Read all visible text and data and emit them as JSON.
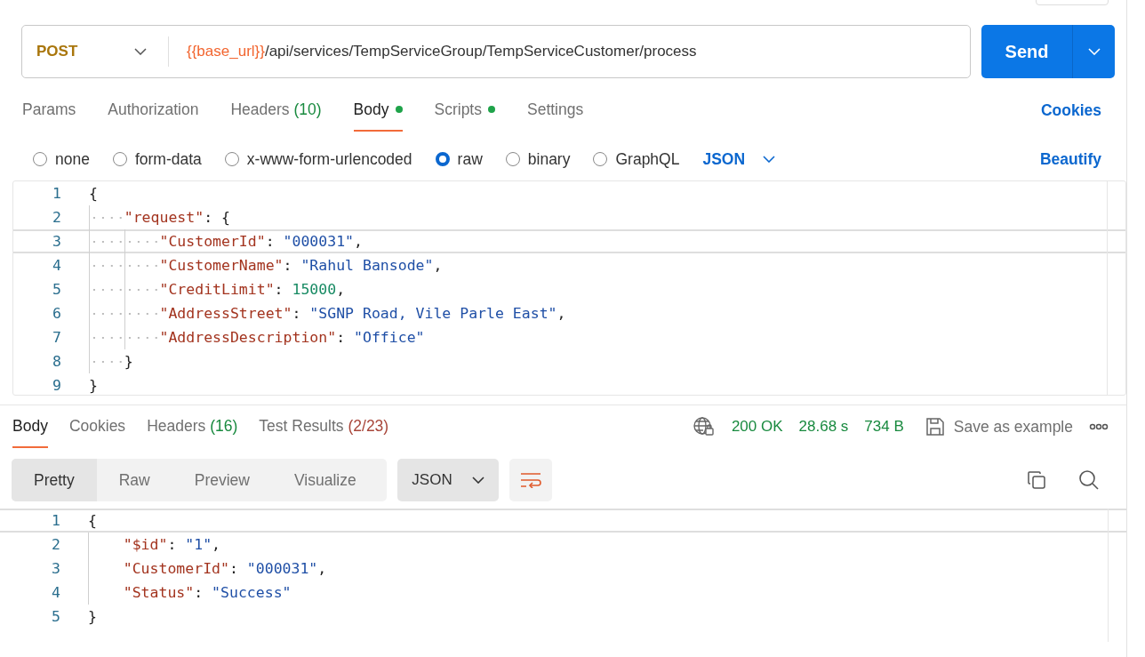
{
  "request_bar": {
    "method": "POST",
    "url_variable": "{{base_url}}",
    "url_path": "/api/services/TempServiceGroup/TempServiceCustomer/process",
    "send_label": "Send"
  },
  "request_tabs": [
    {
      "label": "Params",
      "selected": false,
      "dot": false
    },
    {
      "label": "Authorization",
      "selected": false,
      "dot": false
    },
    {
      "label": "Headers",
      "count": {
        "text": "(10)",
        "color": "#198a3f"
      },
      "selected": false,
      "dot": false
    },
    {
      "label": "Body",
      "selected": true,
      "dot": true
    },
    {
      "label": "Scripts",
      "selected": false,
      "dot": true
    },
    {
      "label": "Settings",
      "selected": false,
      "dot": false
    }
  ],
  "cookies_link": "Cookies",
  "body_modes": [
    {
      "label": "none",
      "selected": false
    },
    {
      "label": "form-data",
      "selected": false
    },
    {
      "label": "x-www-form-urlencoded",
      "selected": false
    },
    {
      "label": "raw",
      "selected": true
    },
    {
      "label": "binary",
      "selected": false
    },
    {
      "label": "GraphQL",
      "selected": false
    }
  ],
  "body_format": "JSON",
  "beautify_link": "Beautify",
  "request_editor": {
    "show_whitespace": true,
    "lines": [
      {
        "number": "1",
        "current": false,
        "tokens": [
          {
            "kind": "punct",
            "text": "{"
          }
        ],
        "children": [
          {
            "number": "2",
            "current": false,
            "tokens": [
              {
                "kind": "key",
                "text": "\"request\""
              },
              {
                "kind": "punct",
                "text": ": {"
              }
            ],
            "children": [
              {
                "number": "3",
                "current": true,
                "tokens": [
                  {
                    "kind": "key",
                    "text": "\"CustomerId\""
                  },
                  {
                    "kind": "punct",
                    "text": ": "
                  },
                  {
                    "kind": "string",
                    "text": "\"000031\""
                  },
                  {
                    "kind": "punct",
                    "text": ","
                  }
                ]
              },
              {
                "number": "4",
                "current": false,
                "tokens": [
                  {
                    "kind": "key",
                    "text": "\"CustomerName\""
                  },
                  {
                    "kind": "punct",
                    "text": ": "
                  },
                  {
                    "kind": "string",
                    "text": "\"Rahul Bansode\""
                  },
                  {
                    "kind": "punct",
                    "text": ","
                  }
                ]
              },
              {
                "number": "5",
                "current": false,
                "tokens": [
                  {
                    "kind": "key",
                    "text": "\"CreditLimit\""
                  },
                  {
                    "kind": "punct",
                    "text": ": "
                  },
                  {
                    "kind": "number",
                    "text": "15000"
                  },
                  {
                    "kind": "punct",
                    "text": ","
                  }
                ]
              },
              {
                "number": "6",
                "current": false,
                "tokens": [
                  {
                    "kind": "key",
                    "text": "\"AddressStreet\""
                  },
                  {
                    "kind": "punct",
                    "text": ": "
                  },
                  {
                    "kind": "string",
                    "text": "\"SGNP Road, Vile Parle East\""
                  },
                  {
                    "kind": "punct",
                    "text": ","
                  }
                ]
              },
              {
                "number": "7",
                "current": false,
                "tokens": [
                  {
                    "kind": "key",
                    "text": "\"AddressDescription\""
                  },
                  {
                    "kind": "punct",
                    "text": ": "
                  },
                  {
                    "kind": "string",
                    "text": "\"Office\""
                  }
                ]
              }
            ]
          },
          {
            "number": "8",
            "current": false,
            "tokens": [
              {
                "kind": "punct",
                "text": "}"
              }
            ]
          }
        ]
      },
      {
        "number": "9",
        "current": false,
        "tokens": [
          {
            "kind": "punct",
            "text": "}"
          }
        ]
      }
    ]
  },
  "response_tabs": [
    {
      "label": "Body",
      "selected": true
    },
    {
      "label": "Cookies",
      "selected": false
    },
    {
      "label": "Headers",
      "count": {
        "text": "(16)",
        "color": "#198a3f"
      },
      "selected": false
    },
    {
      "label": "Test Results",
      "count": {
        "text": "(2/23)",
        "color": "#a8463a"
      },
      "selected": false
    }
  ],
  "response_status": {
    "status": "200 OK",
    "time": "28.68 s",
    "size": "734 B",
    "save_label": "Save as example"
  },
  "response_views": [
    {
      "label": "Pretty",
      "selected": true
    },
    {
      "label": "Raw",
      "selected": false
    },
    {
      "label": "Preview",
      "selected": false
    },
    {
      "label": "Visualize",
      "selected": false
    }
  ],
  "response_format": "JSON",
  "response_editor": {
    "show_whitespace": false,
    "lines": [
      {
        "number": "1",
        "current": true,
        "tokens": [
          {
            "kind": "punct",
            "text": "{"
          }
        ],
        "children": [
          {
            "number": "2",
            "current": false,
            "tokens": [
              {
                "kind": "key",
                "text": "\"$id\""
              },
              {
                "kind": "punct",
                "text": ": "
              },
              {
                "kind": "string",
                "text": "\"1\""
              },
              {
                "kind": "punct",
                "text": ","
              }
            ]
          },
          {
            "number": "3",
            "current": false,
            "tokens": [
              {
                "kind": "key",
                "text": "\"CustomerId\""
              },
              {
                "kind": "punct",
                "text": ": "
              },
              {
                "kind": "string",
                "text": "\"000031\""
              },
              {
                "kind": "punct",
                "text": ","
              }
            ]
          },
          {
            "number": "4",
            "current": false,
            "tokens": [
              {
                "kind": "key",
                "text": "\"Status\""
              },
              {
                "kind": "punct",
                "text": ": "
              },
              {
                "kind": "string",
                "text": "\"Success\""
              }
            ]
          }
        ]
      },
      {
        "number": "5",
        "current": false,
        "tokens": [
          {
            "kind": "punct",
            "text": "}"
          }
        ]
      }
    ]
  }
}
